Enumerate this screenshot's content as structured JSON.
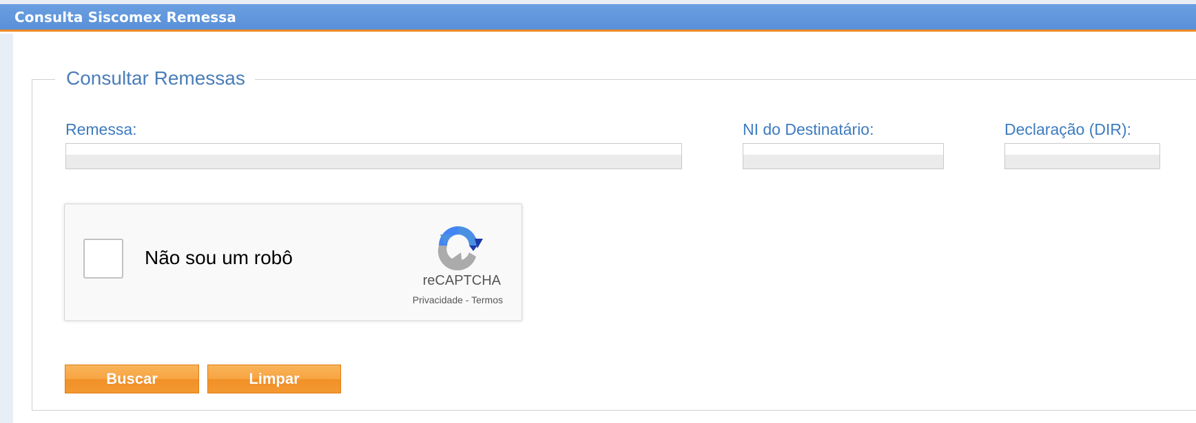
{
  "header": {
    "title": "Consulta Siscomex Remessa"
  },
  "form": {
    "legend": "Consultar Remessas",
    "fields": {
      "remessa": {
        "label": "Remessa:",
        "value": ""
      },
      "ni_destinatario": {
        "label": "NI do Destinatário:",
        "value": ""
      },
      "declaracao": {
        "label": "Declaração (DIR):",
        "value": ""
      }
    }
  },
  "captcha": {
    "checkbox_label": "Não sou um robô",
    "brand": "reCAPTCHA",
    "privacy_link": "Privacidade",
    "separator": " - ",
    "terms_link": "Termos",
    "icon": "recaptcha-logo-icon"
  },
  "buttons": {
    "search": "Buscar",
    "clear": "Limpar"
  },
  "colors": {
    "header_bg": "#5a90d8",
    "header_accent": "#f0891f",
    "label_color": "#3d7bbf",
    "button_orange": "#f39930"
  }
}
